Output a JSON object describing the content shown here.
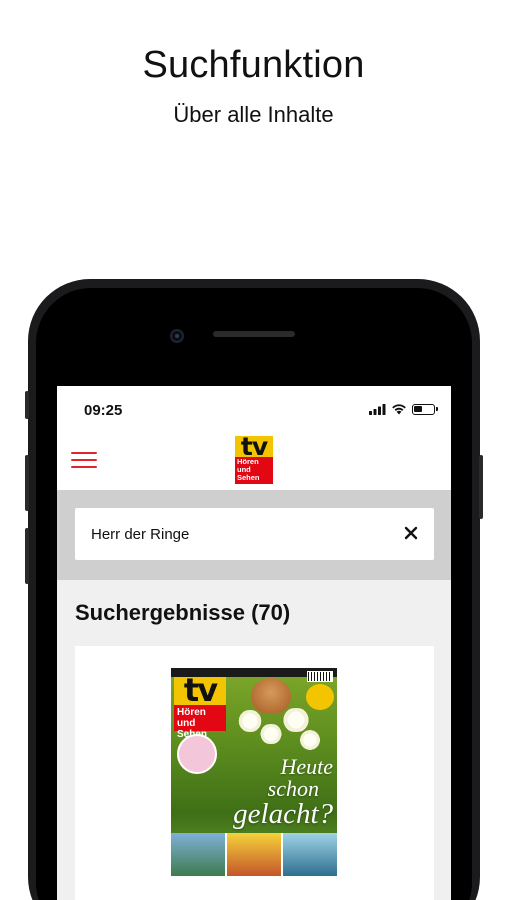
{
  "promo": {
    "title": "Suchfunktion",
    "subtitle": "Über alle Inhalte"
  },
  "status_bar": {
    "time": "09:25",
    "icons": [
      "signal-icon",
      "wifi-icon",
      "battery-icon"
    ]
  },
  "header": {
    "menu_icon": "hamburger-menu-icon",
    "logo": {
      "tv": "tv",
      "line1": "Hören",
      "line2": "und",
      "line3": "Sehen"
    }
  },
  "search": {
    "value": "Herr der Ringe",
    "clear_icon": "close-icon"
  },
  "results": {
    "heading": "Suchergebnisse (70)",
    "items": [
      {
        "type": "magazine-cover",
        "cover_headline_1": "Heute",
        "cover_headline_2": "schon",
        "cover_headline_3": "gelacht?"
      }
    ]
  },
  "colors": {
    "accent_red": "#e2242e",
    "logo_yellow": "#f2c500",
    "logo_red": "#e30613",
    "search_band": "#cfcfcf",
    "results_bg": "#f0f0f0"
  }
}
